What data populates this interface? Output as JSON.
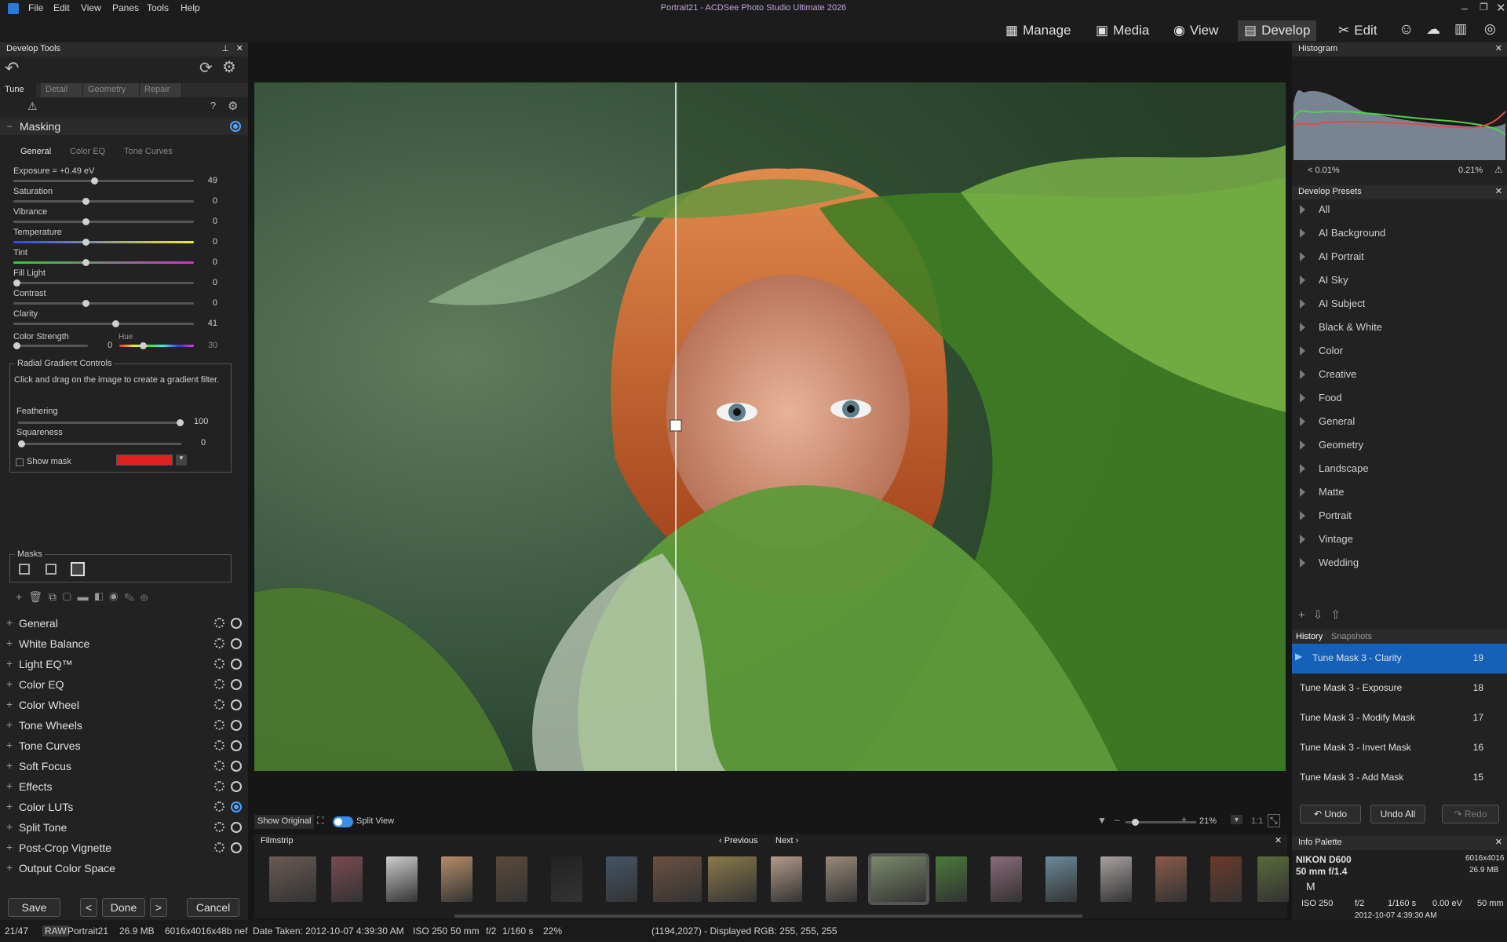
{
  "window": {
    "title": "Portrait21 - ACDSee Photo Studio Ultimate 2026"
  },
  "menu": [
    "File",
    "Edit",
    "View",
    "Panes",
    "Tools",
    "Help"
  ],
  "modes": {
    "manage": "Manage",
    "media": "Media",
    "view": "View",
    "develop": "Develop",
    "edit": "Edit"
  },
  "develop_tools": {
    "title": "Develop Tools",
    "tabs": {
      "tune": "Tune",
      "detail": "Detail",
      "geometry": "Geometry",
      "repair": "Repair"
    },
    "masking": {
      "title": "Masking",
      "subtabs": {
        "general": "General",
        "color_eq": "Color EQ",
        "tone_curves": "Tone Curves"
      },
      "sliders": [
        {
          "label": "Exposure = +0.49 eV",
          "value": "49",
          "pos": 0.45
        },
        {
          "label": "Saturation",
          "value": "0",
          "pos": 0.4
        },
        {
          "label": "Vibrance",
          "value": "0",
          "pos": 0.4
        },
        {
          "label": "Temperature",
          "value": "0",
          "pos": 0.4
        },
        {
          "label": "Tint",
          "value": "0",
          "pos": 0.4
        },
        {
          "label": "Fill Light",
          "value": "0",
          "pos": 0.0
        },
        {
          "label": "Contrast",
          "value": "0",
          "pos": 0.4
        },
        {
          "label": "Clarity",
          "value": "41",
          "pos": 0.57
        }
      ],
      "color_strength": {
        "label": "Color Strength",
        "value": "0",
        "hue_label": "Hue",
        "hue_value": "30"
      },
      "radial": {
        "title": "Radial Gradient Controls",
        "hint": "Click and drag on the image to create a gradient filter.",
        "feathering_label": "Feathering",
        "feathering_value": "100",
        "squareness_label": "Squareness",
        "squareness_value": "0",
        "show_mask": "Show mask"
      },
      "masks_label": "Masks"
    },
    "sections": [
      "General",
      "White Balance",
      "Light EQ™",
      "Color EQ",
      "Color Wheel",
      "Tone Wheels",
      "Tone Curves",
      "Soft Focus",
      "Effects",
      "Color LUTs",
      "Split Tone",
      "Post-Crop Vignette",
      "Output Color Space"
    ],
    "buttons": {
      "save": "Save",
      "done": "Done",
      "cancel": "Cancel"
    }
  },
  "histogram": {
    "title": "Histogram",
    "low": "< 0.01%",
    "high": "0.21%"
  },
  "presets": {
    "title": "Develop Presets",
    "items": [
      "All",
      "AI Background",
      "AI Portrait",
      "AI Sky",
      "AI Subject",
      "Black & White",
      "Color",
      "Creative",
      "Food",
      "General",
      "Geometry",
      "Landscape",
      "Matte",
      "Portrait",
      "Vintage",
      "Wedding"
    ]
  },
  "history": {
    "tabs": {
      "history": "History",
      "snapshots": "Snapshots"
    },
    "items": [
      {
        "name": "Tune Mask 3 - Clarity",
        "num": "19"
      },
      {
        "name": "Tune Mask 3 - Exposure",
        "num": "18"
      },
      {
        "name": "Tune Mask 3 - Modify Mask",
        "num": "17"
      },
      {
        "name": "Tune Mask 3 - Invert Mask",
        "num": "16"
      },
      {
        "name": "Tune Mask 3 - Add Mask",
        "num": "15"
      }
    ],
    "buttons": {
      "undo": "Undo",
      "undo_all": "Undo All",
      "redo": "Redo"
    }
  },
  "info": {
    "title": "Info Palette",
    "camera": "NIKON D600",
    "lens": "50 mm f/1.4",
    "dims": "6016x4016",
    "size": "26.9 MB",
    "mode": "M",
    "iso": "ISO 250",
    "fstop": "f/2",
    "shutter": "1/160 s",
    "ev": "0.00 eV",
    "focal": "50 mm",
    "date": "2012-10-07 4:39:30 AM"
  },
  "viewer": {
    "show_original": "Show Original",
    "split_view": "Split View",
    "zoom": "21%",
    "one_to_one": "1:1"
  },
  "filmstrip": {
    "title": "Filmstrip",
    "previous": "Previous",
    "next": "Next"
  },
  "status": {
    "index": "21/47",
    "raw": "RAW",
    "file": "Portrait21",
    "size": "26.9 MB",
    "dims": "6016x4016x48b nef",
    "date": "Date Taken: 2012-10-07 4:39:30 AM",
    "iso": "ISO 250",
    "focal": "50 mm",
    "fstop": "f/2",
    "shutter": "1/160 s",
    "zoom": "22%",
    "coords": "(1194,2027) - Displayed RGB: 255, 255, 255"
  }
}
